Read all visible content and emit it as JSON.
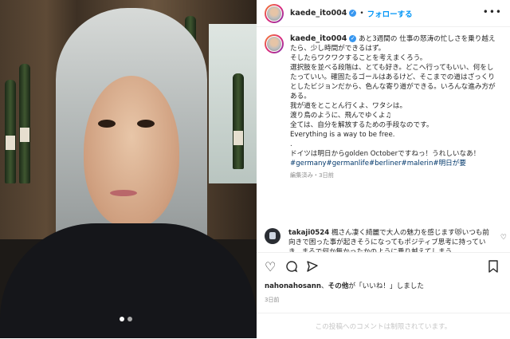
{
  "post": {
    "username": "kaede_ito004",
    "follow_label": "フォローする",
    "separator": "•",
    "more_label": "•••"
  },
  "caption": {
    "username": "kaede_ito004",
    "lines": [
      "あと3週間の 仕事の怒涛の忙しさを乗り越えたら、少し時間ができるはず。",
      "そしたらワクワクすることを考えまくろう。",
      "選択肢を並べる段階は、とても好き。どこへ行ってもいい、何をしたっていい。確固たるゴールはあるけど、そこまでの道はざっくりとしたビジョンだから、色んな寄り道ができる。いろんな進み方がある。",
      "",
      "我が道をとことん行くよ、ワタシは。",
      "渡り鳥のように、飛んでゆくよ♫",
      "",
      "全ては、自分を解放するための手段なのです。",
      "Everything is a way to be free.",
      ".",
      "ドイツは明日からgolden Octoberですねっ！うれしいなあ！"
    ],
    "hashtags": "#germany#germanlife#berliner#malerin#明日が要",
    "meta": "編集済み・3日前"
  },
  "comment": {
    "username": "takaji0524",
    "text": "楓さん凄く綺麗で大人の魅力を感じます😻いつも前向きで困った事が起きそうになってもポジティブ思考に持っていき、まるで何か無かったかのように乗り越えてしまう"
  },
  "likes": {
    "prefix": "nahonahosann",
    "middle": "、",
    "bold_part": "その他",
    "suffix": "が「いいね！」しました"
  },
  "date": "3日前",
  "comment_bar": "この投稿へのコメントは制限されています。",
  "icons": {
    "heart": "heart-icon",
    "comment": "comment-icon",
    "share": "share-icon",
    "bookmark": "bookmark-icon"
  },
  "colors": {
    "link_blue": "#0095f6",
    "hashtag": "#00376b",
    "muted": "#8e8e8e"
  }
}
